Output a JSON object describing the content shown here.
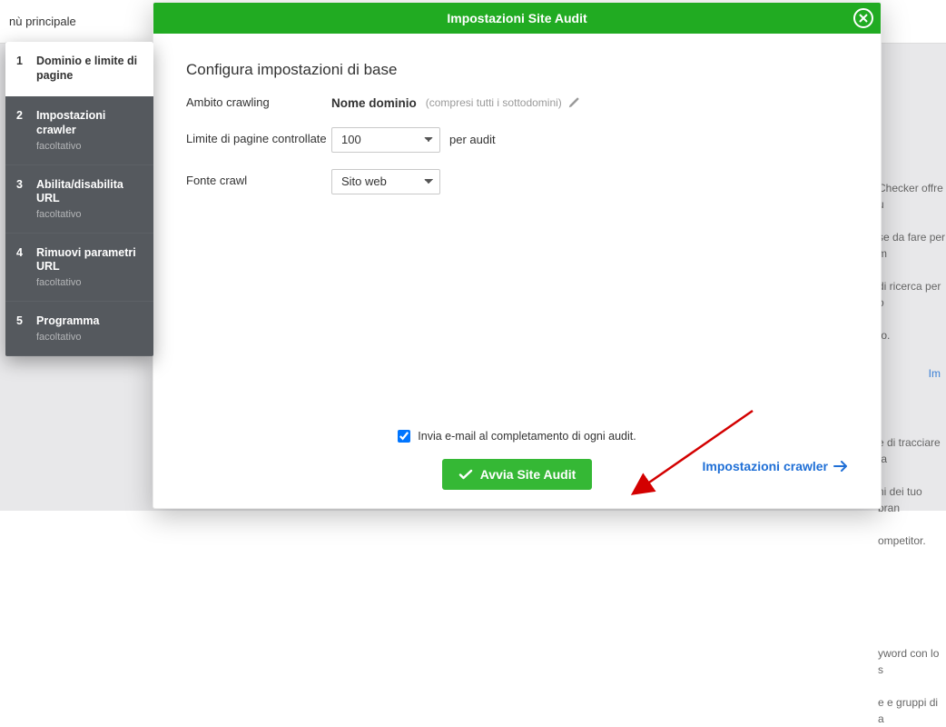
{
  "backdrop": {
    "menu_label": "nù principale",
    "right_snips": [
      "Checker offre u",
      "se da fare per m",
      "di ricerca per o",
      "to.",
      "",
      "",
      "e di tracciare fa",
      "ni dei tuo bran",
      "ompetitor.",
      "",
      "",
      "yword con lo s",
      "e e gruppi di a"
    ],
    "right_link": "Im"
  },
  "modal": {
    "title": "Impostazioni Site Audit",
    "section_title": "Configura impostazioni di base",
    "rows": {
      "scope_label": "Ambito crawling",
      "domain_field_label": "Nome dominio",
      "domain_hint": "(compresi tutti i sottodomini)",
      "limit_label": "Limite di pagine controllate",
      "limit_value": "100",
      "limit_suffix": "per audit",
      "source_label": "Fonte crawl",
      "source_value": "Sito web"
    },
    "checkbox_label": "Invia e-mail al completamento di ogni audit.",
    "primary_button": "Avvia Site Audit",
    "next_link": "Impostazioni crawler"
  },
  "wizard": {
    "steps": [
      {
        "num": "1",
        "title": "Dominio e limite di pagine",
        "sub": ""
      },
      {
        "num": "2",
        "title": "Impostazioni crawler",
        "sub": "facoltativo"
      },
      {
        "num": "3",
        "title": "Abilita/disabilita URL",
        "sub": "facoltativo"
      },
      {
        "num": "4",
        "title": "Rimuovi parametri URL",
        "sub": "facoltativo"
      },
      {
        "num": "5",
        "title": "Programma",
        "sub": "facoltativo"
      }
    ]
  }
}
